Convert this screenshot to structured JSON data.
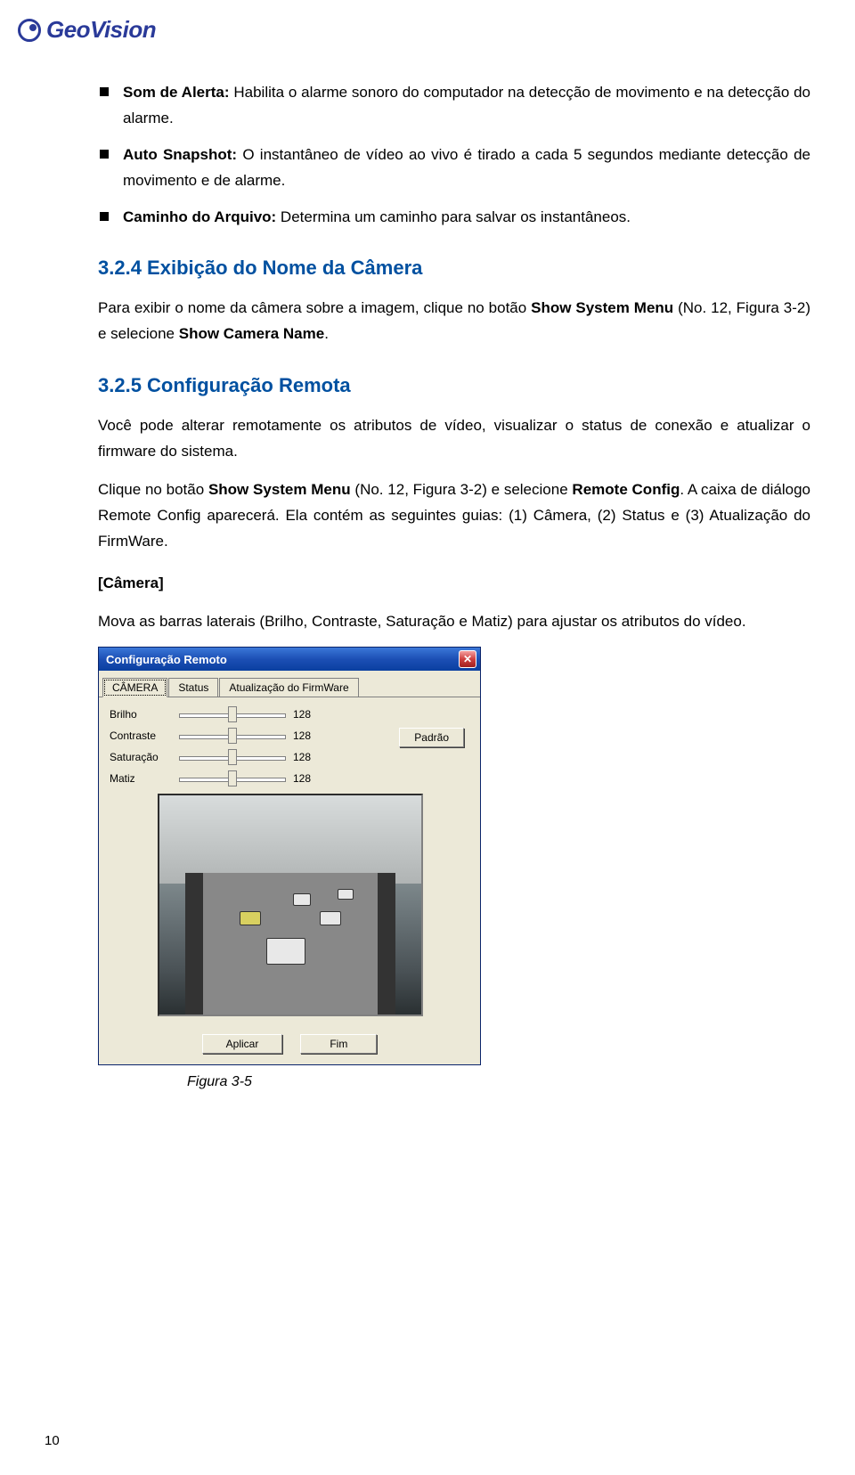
{
  "logo": {
    "brand": "GeoVision"
  },
  "bullets": [
    {
      "term": "Som de Alerta:",
      "text": " Habilita o alarme sonoro do computador na detecção de movimento e na detecção do alarme."
    },
    {
      "term": "Auto Snapshot:",
      "text": " O instantâneo de vídeo ao vivo é tirado a cada 5 segundos mediante detecção de movimento e de alarme."
    },
    {
      "term": "Caminho do Arquivo:",
      "text": " Determina um caminho para salvar os instantâneos."
    }
  ],
  "sections": {
    "s1": {
      "heading": "3.2.4 Exibição do Nome da Câmera",
      "para_prefix": "Para exibir o nome da câmera sobre a imagem, clique no botão ",
      "bold1": "Show System Menu",
      "mid1": " (No. 12, Figura 3-2) e selecione ",
      "bold2": "Show Camera Name",
      "suffix": "."
    },
    "s2": {
      "heading": "3.2.5 Configuração Remota",
      "p1": "Você pode alterar remotamente os atributos de vídeo, visualizar o status de conexão e atualizar o firmware do sistema.",
      "p2_prefix": "Clique no botão ",
      "p2_bold1": "Show System Menu",
      "p2_mid1": " (No. 12, Figura 3-2) e selecione ",
      "p2_bold2": "Remote Config",
      "p2_suffix": ". A caixa de diálogo Remote Config aparecerá. Ela contém as seguintes guias: (1) Câmera, (2) Status e (3) Atualização do FirmWare.",
      "camera_h": "[Câmera]",
      "p3": "Mova as barras laterais (Brilho, Contraste, Saturação e Matiz) para ajustar os atributos do vídeo."
    }
  },
  "dialog": {
    "title": "Configuração Remoto",
    "tabs": {
      "t1": "CÂMERA",
      "t2": "Status",
      "t3": "Atualização do FirmWare"
    },
    "sliders": [
      {
        "label": "Brilho",
        "value": "128"
      },
      {
        "label": "Contraste",
        "value": "128"
      },
      {
        "label": "Saturação",
        "value": "128"
      },
      {
        "label": "Matiz",
        "value": "128"
      }
    ],
    "padrao": "Padrão",
    "aplicar": "Aplicar",
    "fim": "Fim"
  },
  "figure_caption": "Figura 3-5",
  "page_number": "10"
}
